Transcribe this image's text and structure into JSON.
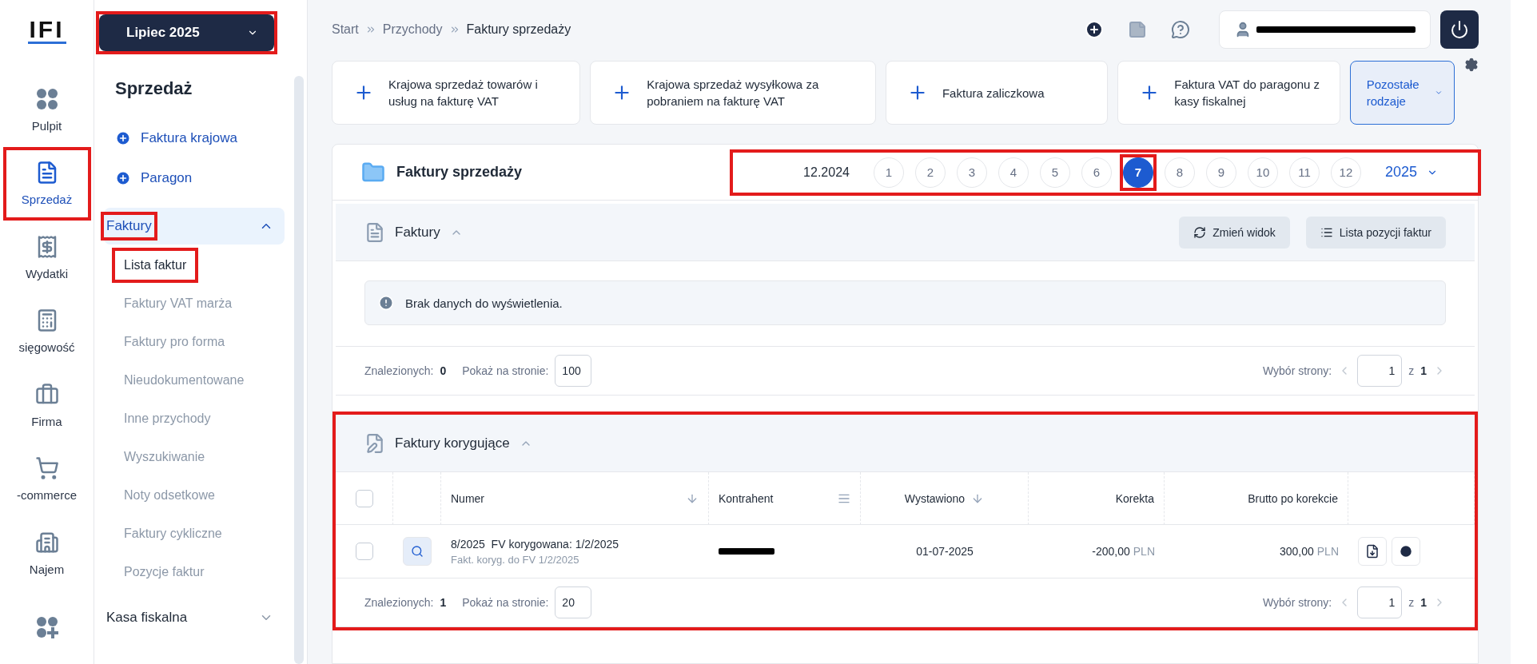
{
  "rail": {
    "logo": "IFI",
    "items": [
      {
        "kind": "dots",
        "label": "Pulpit",
        "selected": false,
        "highlighted": false
      },
      {
        "kind": "invoice",
        "label": "Sprzedaż",
        "selected": true,
        "highlighted": true
      },
      {
        "kind": "receipt",
        "label": "Wydatki",
        "selected": false,
        "highlighted": false
      },
      {
        "kind": "calculator",
        "label": "sięgowość",
        "selected": false,
        "highlighted": false
      },
      {
        "kind": "briefcase",
        "label": "Firma",
        "selected": false,
        "highlighted": false
      },
      {
        "kind": "cart",
        "label": "-commerce",
        "selected": false,
        "highlighted": false
      },
      {
        "kind": "building",
        "label": "Najem",
        "selected": false,
        "highlighted": false
      },
      {
        "kind": "dots-plus",
        "selected": false,
        "highlighted": false
      }
    ]
  },
  "sidebar": {
    "period": {
      "label": "Lipiec 2025",
      "highlighted": true
    },
    "title": "Sprzedaż",
    "actions": [
      "Faktura krajowa",
      "Paragon"
    ],
    "groups": [
      {
        "label": "Faktury",
        "expanded": true,
        "highlighted": true,
        "children": [
          {
            "label": "Lista faktur",
            "selected": true,
            "highlighted": true
          },
          {
            "label": "Faktury VAT marża",
            "selected": false,
            "highlighted": false
          },
          {
            "label": "Faktury pro forma",
            "selected": false,
            "highlighted": false
          },
          {
            "label": "Nieudokumentowane",
            "selected": false,
            "highlighted": false
          },
          {
            "label": "Inne przychody",
            "selected": false,
            "highlighted": false
          },
          {
            "label": "Wyszukiwanie",
            "selected": false,
            "highlighted": false
          },
          {
            "label": "Noty odsetkowe",
            "selected": false,
            "highlighted": false
          },
          {
            "label": "Faktury cykliczne",
            "selected": false,
            "highlighted": false
          },
          {
            "label": "Pozycje faktur",
            "selected": false,
            "highlighted": false
          }
        ]
      },
      {
        "label": "Kasa fiskalna",
        "expanded": false,
        "highlighted": false
      }
    ]
  },
  "breadcrumb": [
    "Start",
    "Przychody",
    "Faktury sprzedaży"
  ],
  "quick_add": [
    "Krajowa sprzedaż towarów i usług na fakturę VAT",
    "Krajowa sprzedaż wysyłkowa za pobraniem na fakturę VAT",
    "Faktura zaliczkowa",
    "Faktura VAT do paragonu z kasy fiskalnej"
  ],
  "more_types": "Pozostałe rodzaje",
  "panel": {
    "title": "Faktury sprzedaży",
    "period_strip": {
      "highlighted": true,
      "prev": "12.2024",
      "year": "2025",
      "months": [
        {
          "label": "1",
          "selected": false,
          "highlighted": false
        },
        {
          "label": "2",
          "selected": false,
          "highlighted": false
        },
        {
          "label": "3",
          "selected": false,
          "highlighted": false
        },
        {
          "label": "4",
          "selected": false,
          "highlighted": false
        },
        {
          "label": "5",
          "selected": false,
          "highlighted": false
        },
        {
          "label": "6",
          "selected": false,
          "highlighted": false
        },
        {
          "label": "7",
          "selected": true,
          "highlighted": true
        },
        {
          "label": "8",
          "selected": false,
          "highlighted": false
        },
        {
          "label": "9",
          "selected": false,
          "highlighted": false
        },
        {
          "label": "10",
          "selected": false,
          "highlighted": false
        },
        {
          "label": "11",
          "selected": false,
          "highlighted": false
        },
        {
          "label": "12",
          "selected": false,
          "highlighted": false
        }
      ]
    },
    "sections": [
      {
        "kind": "empty",
        "title": "Faktury",
        "expanded": true,
        "highlighted": false,
        "buttons": [
          "Zmień widok",
          "Lista pozycji faktur"
        ],
        "message": "Brak danych do wyświetlenia.",
        "footer": {
          "found_label": "Znalezionych:",
          "found": "0",
          "per_page_label": "Pokaż na stronie:",
          "per_page": "100",
          "page_label": "Wybór strony:",
          "page": "1",
          "of_label": "z",
          "pages": "1"
        }
      },
      {
        "kind": "table",
        "title": "Faktury korygujące",
        "expanded": true,
        "highlighted": true,
        "all_checked": false,
        "columns": [
          {
            "label": "Numer",
            "kind": "sort"
          },
          {
            "label": "Kontrahent",
            "kind": "menu"
          },
          {
            "label": "Wystawiono",
            "kind": "sort"
          },
          {
            "label": "Korekta",
            "kind": "plain"
          },
          {
            "label": "Brutto po korekcie",
            "kind": "plain"
          }
        ],
        "rows": [
          {
            "checked": false,
            "number": "8/2025",
            "corrected": "FV korygowana: 1/2/2025",
            "note": "Fakt. koryg. do FV 1/2/2025",
            "date": "01-07-2025",
            "correction": "-200,00",
            "correction_currency": "PLN",
            "gross": "300,00",
            "gross_currency": "PLN"
          }
        ],
        "footer": {
          "found_label": "Znalezionych:",
          "found": "1",
          "per_page_label": "Pokaż na stronie:",
          "per_page": "20",
          "page_label": "Wybór strony:",
          "page": "1",
          "of_label": "z",
          "pages": "1"
        }
      }
    ]
  }
}
